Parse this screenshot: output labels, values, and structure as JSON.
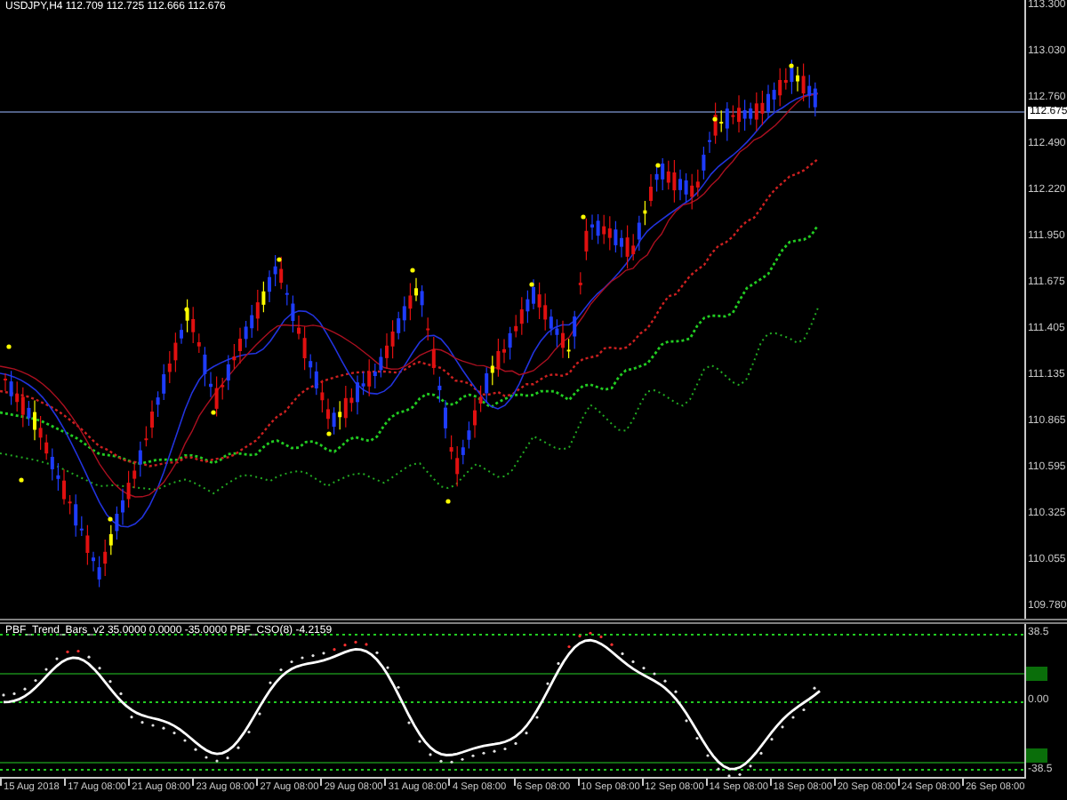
{
  "chart_header": {
    "symbol_text": "USDJPY,H4  112.709 112.725 112.666 112.676"
  },
  "price_axis": {
    "labels": [
      "113.300",
      "113.030",
      "112.760",
      "112.490",
      "112.220",
      "111.950",
      "111.675",
      "111.405",
      "111.135",
      "110.865",
      "110.595",
      "110.325",
      "110.055",
      "109.780"
    ],
    "current_price": "112.675"
  },
  "indicator": {
    "title": "PBF_Trend_Bars_v2 35.0000 0.0000 -35.0000  PBF_CSO(8) -4.2159",
    "axis_labels": [
      "38.5",
      "0.00",
      "-38.5"
    ]
  },
  "time_axis": {
    "labels": [
      "15 Aug 2018",
      "17 Aug 08:00",
      "21 Aug 08:00",
      "23 Aug 08:00",
      "27 Aug 08:00",
      "29 Aug 08:00",
      "31 Aug 08:00",
      "4 Sep 08:00",
      "6 Sep 08:00",
      "10 Sep 08:00",
      "12 Sep 08:00",
      "14 Sep 08:00",
      "18 Sep 08:00",
      "20 Sep 08:00",
      "24 Sep 08:00",
      "26 Sep 08:00"
    ]
  }
}
